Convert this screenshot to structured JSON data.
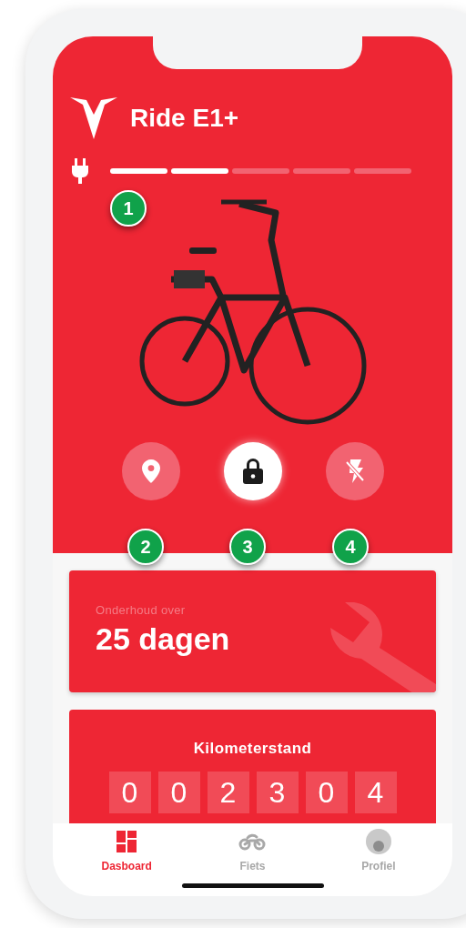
{
  "header": {
    "title": "Ride E1+"
  },
  "battery": {
    "level": 0.4
  },
  "actions": [
    {
      "kind": "location",
      "selected": false
    },
    {
      "kind": "lock",
      "selected": true
    },
    {
      "kind": "flash-off",
      "selected": false
    }
  ],
  "callouts": [
    "1",
    "2",
    "3",
    "4"
  ],
  "maintenance": {
    "label": "Onderhoud over",
    "value": "25 dagen"
  },
  "odometer": {
    "title": "Kilometerstand",
    "digits": [
      "0",
      "0",
      "2",
      "3",
      "0",
      "4"
    ]
  },
  "nav": [
    {
      "kind": "dashboard",
      "label": "Dasboard",
      "selected": true
    },
    {
      "kind": "bike",
      "label": "Fiets",
      "selected": false
    },
    {
      "kind": "profile",
      "label": "Profiel",
      "selected": false
    }
  ]
}
